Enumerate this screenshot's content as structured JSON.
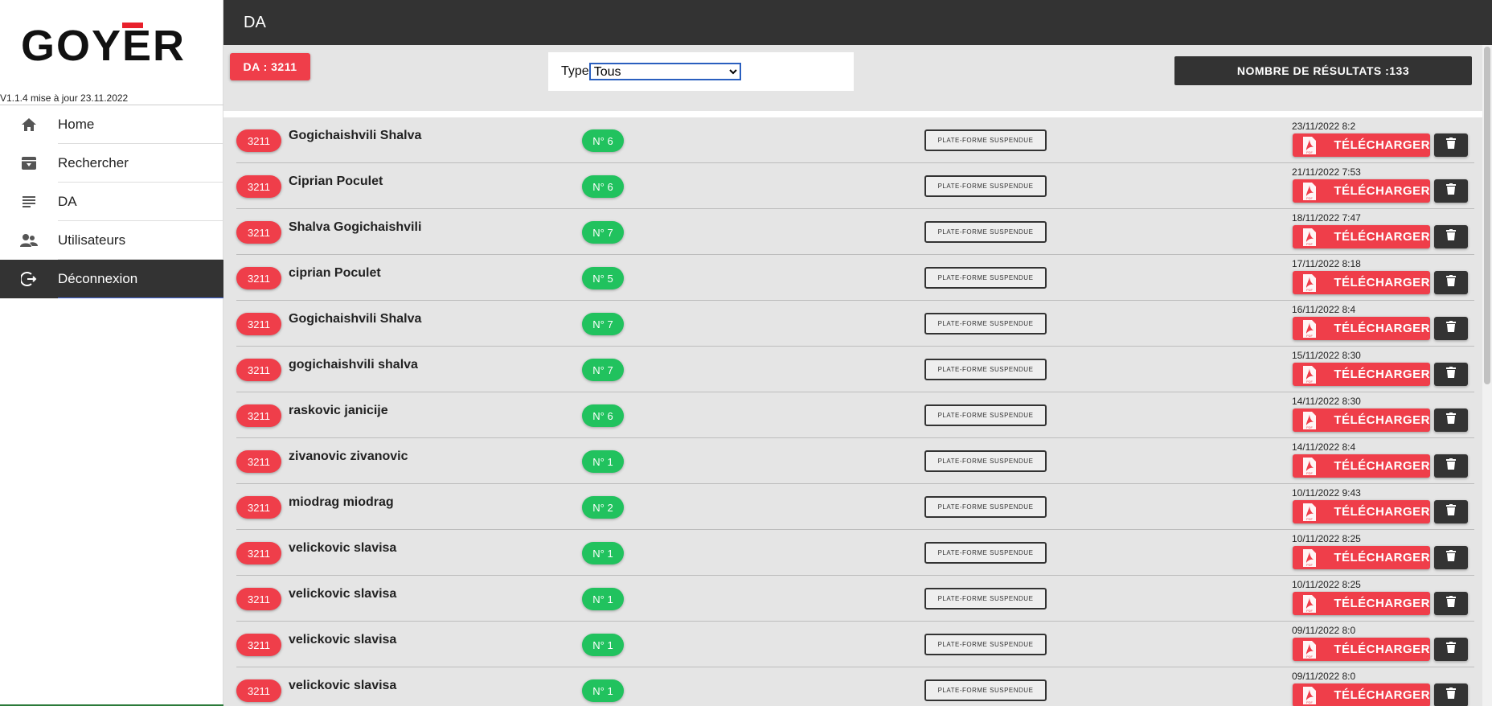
{
  "brand": {
    "logo_text": "GOYER",
    "version": "V1.1.4 mise à jour 23.11.2022",
    "accent": "#e8202b"
  },
  "sidebar": {
    "items": [
      {
        "label": "Home",
        "icon": "home-icon"
      },
      {
        "label": "Rechercher",
        "icon": "archive-icon"
      },
      {
        "label": "DA",
        "icon": "list-icon"
      },
      {
        "label": "Utilisateurs",
        "icon": "users-icon"
      },
      {
        "label": "Déconnexion",
        "icon": "logout-icon",
        "active": true
      }
    ]
  },
  "header": {
    "title": "DA"
  },
  "filter": {
    "da_badge": "DA : 3211",
    "type_label": "Type",
    "type_selected": "Tous",
    "results_label": "NOMBRE DE RÉSULTATS :133"
  },
  "colors": {
    "red": "#ef3e4a",
    "green": "#21c25e",
    "dark": "#333333"
  },
  "rows": [
    {
      "num": "3211",
      "name": "Gogichaishvili Shalva",
      "n": "N° 6",
      "status": "PLATE-FORME SUSPENDUE",
      "date": "23/11/2022 8:2",
      "download": "TÉLÉCHARGER"
    },
    {
      "num": "3211",
      "name": "Ciprian Poculet",
      "n": "N° 6",
      "status": "PLATE-FORME SUSPENDUE",
      "date": "21/11/2022 7:53",
      "download": "TÉLÉCHARGER"
    },
    {
      "num": "3211",
      "name": "Shalva Gogichaishvili",
      "n": "N° 7",
      "status": "PLATE-FORME SUSPENDUE",
      "date": "18/11/2022 7:47",
      "download": "TÉLÉCHARGER"
    },
    {
      "num": "3211",
      "name": "ciprian Poculet",
      "n": "N° 5",
      "status": "PLATE-FORME SUSPENDUE",
      "date": "17/11/2022 8:18",
      "download": "TÉLÉCHARGER"
    },
    {
      "num": "3211",
      "name": "Gogichaishvili Shalva",
      "n": "N° 7",
      "status": "PLATE-FORME SUSPENDUE",
      "date": "16/11/2022 8:4",
      "download": "TÉLÉCHARGER"
    },
    {
      "num": "3211",
      "name": "gogichaishvili shalva",
      "n": "N° 7",
      "status": "PLATE-FORME SUSPENDUE",
      "date": "15/11/2022 8:30",
      "download": "TÉLÉCHARGER"
    },
    {
      "num": "3211",
      "name": "raskovic janicije",
      "n": "N° 6",
      "status": "PLATE-FORME SUSPENDUE",
      "date": "14/11/2022 8:30",
      "download": "TÉLÉCHARGER"
    },
    {
      "num": "3211",
      "name": "zivanovic zivanovic",
      "n": "N° 1",
      "status": "PLATE-FORME SUSPENDUE",
      "date": "14/11/2022 8:4",
      "download": "TÉLÉCHARGER"
    },
    {
      "num": "3211",
      "name": "miodrag miodrag",
      "n": "N° 2",
      "status": "PLATE-FORME SUSPENDUE",
      "date": "10/11/2022 9:43",
      "download": "TÉLÉCHARGER"
    },
    {
      "num": "3211",
      "name": "velickovic slavisa",
      "n": "N° 1",
      "status": "PLATE-FORME SUSPENDUE",
      "date": "10/11/2022 8:25",
      "download": "TÉLÉCHARGER"
    },
    {
      "num": "3211",
      "name": "velickovic slavisa",
      "n": "N° 1",
      "status": "PLATE-FORME SUSPENDUE",
      "date": "10/11/2022 8:25",
      "download": "TÉLÉCHARGER"
    },
    {
      "num": "3211",
      "name": "velickovic slavisa",
      "n": "N° 1",
      "status": "PLATE-FORME SUSPENDUE",
      "date": "09/11/2022 8:0",
      "download": "TÉLÉCHARGER"
    },
    {
      "num": "3211",
      "name": "velickovic slavisa",
      "n": "N° 1",
      "status": "PLATE-FORME SUSPENDUE",
      "date": "09/11/2022 8:0",
      "download": "TÉLÉCHARGER"
    }
  ]
}
